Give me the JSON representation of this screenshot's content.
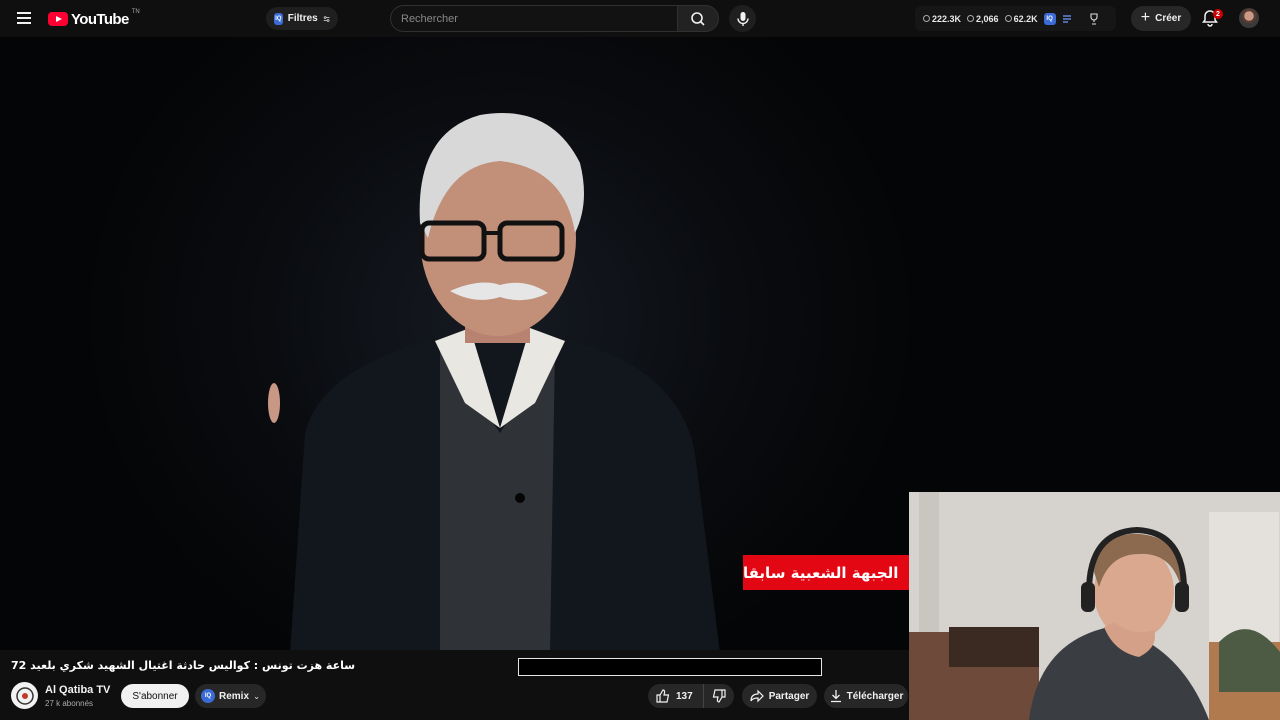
{
  "header": {
    "logo_text": "YouTube",
    "logo_tm": "TN",
    "filters_label": "Filtres",
    "ext_badge": "IQ",
    "search_placeholder": "Rechercher",
    "stats": [
      "222.3K",
      "2,066",
      "62.2K"
    ],
    "create_label": "Créer",
    "notification_count": "2"
  },
  "video": {
    "chyron_text": "الجبهة الشعبية سابقا"
  },
  "info": {
    "title": "72 ساعة هزت تونس : كواليس حادثة اغتيال الشهيد شكري بلعيد",
    "channel_name": "Al Qatiba TV",
    "subscribers": "27 k abonnés",
    "subscribe_label": "S'abonner",
    "remix_label": "Remix",
    "likes": "137",
    "share_label": "Partager",
    "download_label": "Télécharger"
  },
  "colors": {
    "brand_red": "#ff0033",
    "chyron_red": "#e30613",
    "extension_blue": "#3b6bd6"
  }
}
